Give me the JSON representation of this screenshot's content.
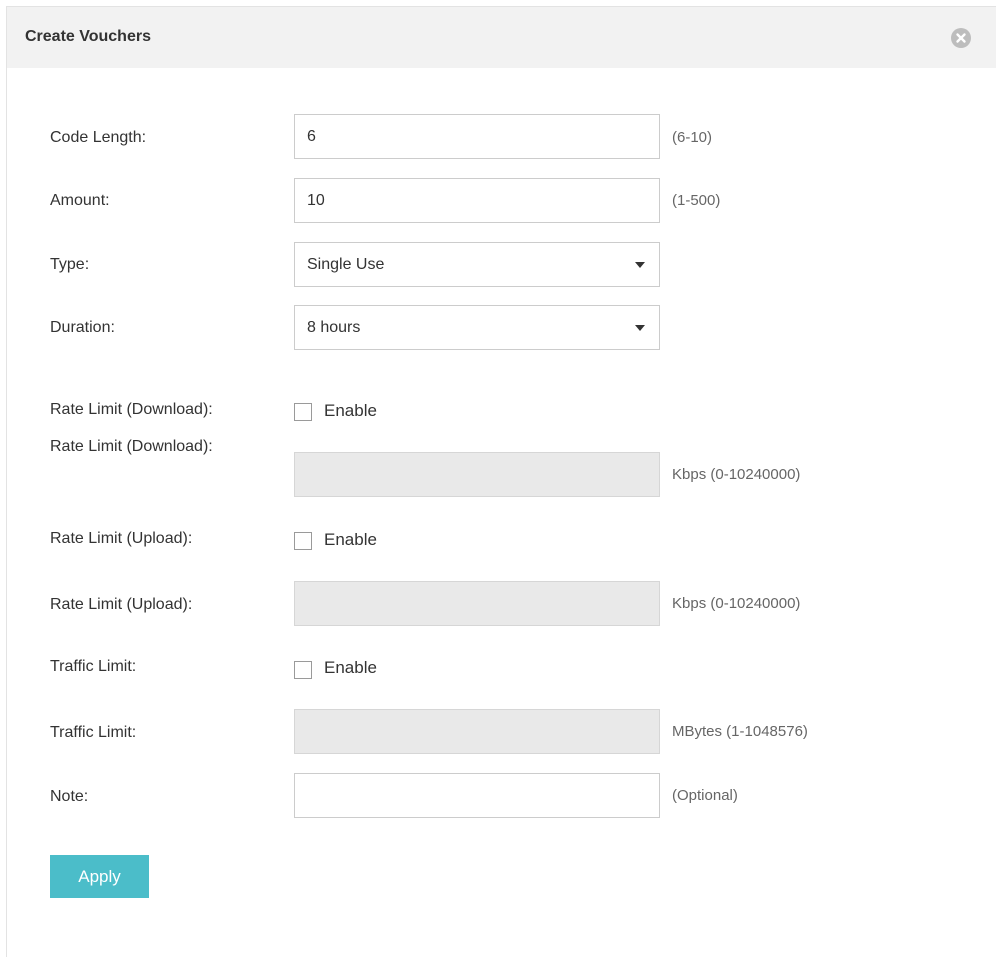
{
  "dialog": {
    "title": "Create Vouchers",
    "close_icon": "close-circle-icon"
  },
  "form": {
    "code_length": {
      "label": "Code Length:",
      "value": "6",
      "hint": "(6-10)"
    },
    "amount": {
      "label": "Amount:",
      "value": "10",
      "hint": "(1-500)"
    },
    "type": {
      "label": "Type:",
      "selected": "Single Use"
    },
    "duration": {
      "label": "Duration:",
      "selected": "8 hours"
    },
    "rate_limit_download_toggle": {
      "label": "Rate Limit (Download):",
      "checkbox_label": "Enable",
      "checked": false
    },
    "rate_limit_download_value": {
      "label": "Rate Limit (Download):",
      "value": "",
      "hint": "Kbps (0-10240000)"
    },
    "rate_limit_upload_toggle": {
      "label": "Rate Limit (Upload):",
      "checkbox_label": "Enable",
      "checked": false
    },
    "rate_limit_upload_value": {
      "label": "Rate Limit (Upload):",
      "value": "",
      "hint": "Kbps (0-10240000)"
    },
    "traffic_limit_toggle": {
      "label": "Traffic Limit:",
      "checkbox_label": "Enable",
      "checked": false
    },
    "traffic_limit_value": {
      "label": "Traffic Limit:",
      "value": "",
      "hint": "MBytes (1-1048576)"
    },
    "note": {
      "label": "Note:",
      "value": "",
      "hint": "(Optional)"
    }
  },
  "actions": {
    "apply_label": "Apply"
  },
  "colors": {
    "accent": "#4bbdc9",
    "header_bg": "#f2f2f2",
    "disabled_input_bg": "#e9e9e9"
  }
}
